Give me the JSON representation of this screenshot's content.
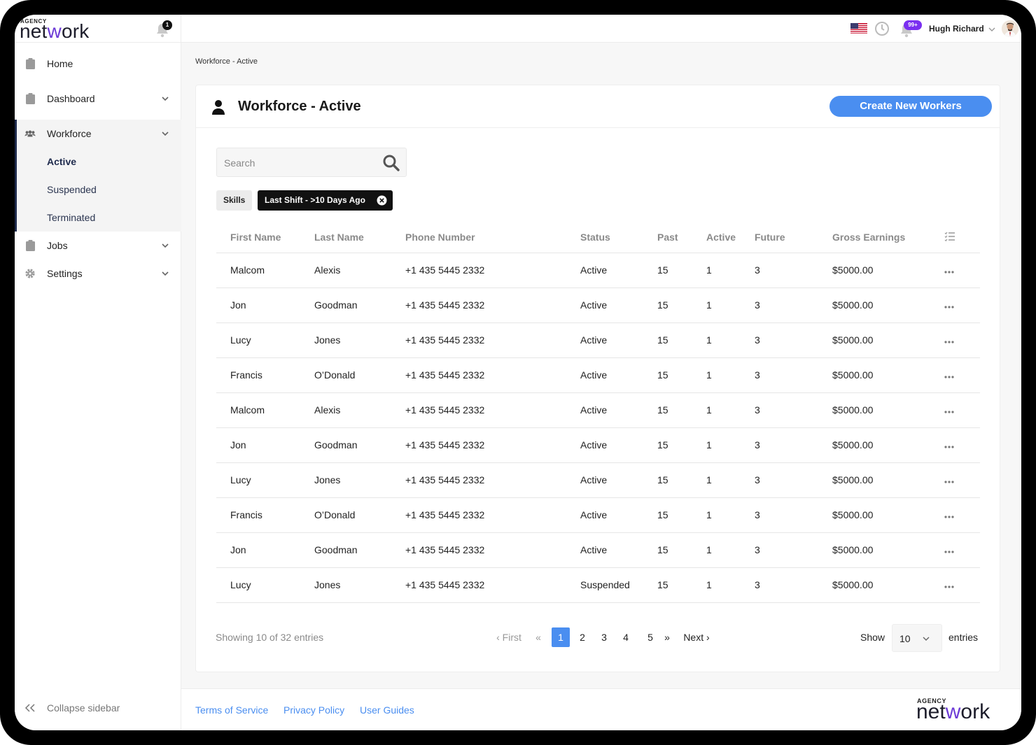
{
  "brand": {
    "agency": "AGENCY",
    "word_pre": "net",
    "word_accent": "w",
    "word_post": "ork"
  },
  "sidebar": {
    "notification_count": "1",
    "items": [
      {
        "label": "Home",
        "icon": "clipboard-icon"
      },
      {
        "label": "Dashboard",
        "icon": "clipboard-icon"
      },
      {
        "label": "Workforce",
        "icon": "users-icon"
      },
      {
        "label": "Jobs",
        "icon": "clipboard-icon"
      },
      {
        "label": "Settings",
        "icon": "gear-icon"
      }
    ],
    "workforce_sub": [
      "Active",
      "Suspended",
      "Terminated"
    ],
    "active_sub": "Active",
    "collapse_label": "Collapse sidebar"
  },
  "topbar": {
    "notification_badge": "99+",
    "user_name": "Hugh Richard"
  },
  "breadcrumb": "Workforce - Active",
  "page": {
    "title": "Workforce - Active",
    "create_button": "Create New Workers",
    "search_placeholder": "Search",
    "filters": {
      "skills": "Skills",
      "active_filter": "Last Shift - >10 Days Ago"
    }
  },
  "table": {
    "columns": [
      "First Name",
      "Last Name",
      "Phone Number",
      "Status",
      "Past",
      "Active",
      "Future",
      "Gross Earnings"
    ],
    "rows": [
      [
        "Malcom",
        "Alexis",
        "+1 435 5445 2332",
        "Active",
        "15",
        "1",
        "3",
        "$5000.00"
      ],
      [
        "Jon",
        "Goodman",
        "+1 435 5445 2332",
        "Active",
        "15",
        "1",
        "3",
        "$5000.00"
      ],
      [
        "Lucy",
        "Jones",
        "+1 435 5445 2332",
        "Active",
        "15",
        "1",
        "3",
        "$5000.00"
      ],
      [
        "Francis",
        "O’Donald",
        "+1 435 5445 2332",
        "Active",
        "15",
        "1",
        "3",
        "$5000.00"
      ],
      [
        "Malcom",
        "Alexis",
        "+1 435 5445 2332",
        "Active",
        "15",
        "1",
        "3",
        "$5000.00"
      ],
      [
        "Jon",
        "Goodman",
        "+1 435 5445 2332",
        "Active",
        "15",
        "1",
        "3",
        "$5000.00"
      ],
      [
        "Lucy",
        "Jones",
        "+1 435 5445 2332",
        "Active",
        "15",
        "1",
        "3",
        "$5000.00"
      ],
      [
        "Francis",
        "O’Donald",
        "+1 435 5445 2332",
        "Active",
        "15",
        "1",
        "3",
        "$5000.00"
      ],
      [
        "Jon",
        "Goodman",
        "+1 435 5445 2332",
        "Active",
        "15",
        "1",
        "3",
        "$5000.00"
      ],
      [
        "Lucy",
        "Jones",
        "+1 435 5445 2332",
        "Suspended",
        "15",
        "1",
        "3",
        "$5000.00"
      ]
    ]
  },
  "pagination": {
    "showing": "Showing 10 of 32 entries",
    "first": "First",
    "prev": "«",
    "pages": [
      "1",
      "2",
      "3",
      "4",
      "5"
    ],
    "current": "1",
    "next_arrow": "»",
    "next": "Next",
    "show_label": "Show",
    "page_size": "10",
    "entries_label": "entries"
  },
  "footer": {
    "links": [
      "Terms of Service",
      "Privacy Policy",
      "User Guides"
    ]
  },
  "colors": {
    "accent": "#4a8ef0",
    "brand_purple": "#6c3ad6",
    "nav_dark": "#1f2b4d",
    "badge_purple": "#7a2ff0"
  }
}
